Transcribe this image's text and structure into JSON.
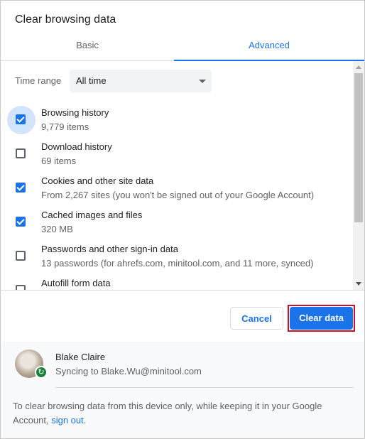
{
  "dialog": {
    "title": "Clear browsing data"
  },
  "tabs": [
    {
      "label": "Basic",
      "selected": false
    },
    {
      "label": "Advanced",
      "selected": true
    }
  ],
  "time_range": {
    "label": "Time range",
    "value": "All time"
  },
  "items": [
    {
      "title": "Browsing history",
      "detail": "9,779 items",
      "checked": true,
      "focused": true
    },
    {
      "title": "Download history",
      "detail": "69 items",
      "checked": false
    },
    {
      "title": "Cookies and other site data",
      "detail": "From 2,267 sites (you won't be signed out of your Google Account)",
      "checked": true
    },
    {
      "title": "Cached images and files",
      "detail": "320 MB",
      "checked": true
    },
    {
      "title": "Passwords and other sign-in data",
      "detail": "13 passwords (for ahrefs.com, minitool.com, and 11 more, synced)",
      "checked": false
    },
    {
      "title": "Autofill form data",
      "detail": "",
      "checked": false
    }
  ],
  "buttons": {
    "cancel": "Cancel",
    "clear": "Clear data"
  },
  "account": {
    "name": "Blake Claire",
    "sync_status": "Syncing to Blake.Wu@minitool.com"
  },
  "footer": {
    "text": "To clear browsing data from this device only, while keeping it in your Google Account, ",
    "link": "sign out",
    "end": "."
  },
  "colors": {
    "accent": "#1a73e8",
    "highlight_outline": "#c8102e",
    "sync_green": "#188038"
  },
  "icons": {
    "dropdown": "chevron-down-icon",
    "checkbox_checked": "check-icon",
    "sync": "sync-icon"
  }
}
